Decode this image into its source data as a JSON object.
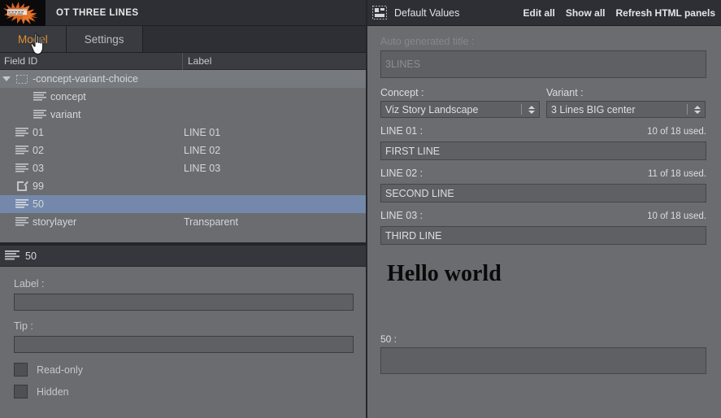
{
  "window": {
    "title": "OT THREE LINES",
    "logo_icon": "orange-splat-logo"
  },
  "tabs": [
    {
      "label": "Model",
      "active": true
    },
    {
      "label": "Settings",
      "active": false
    }
  ],
  "tree": {
    "columns": [
      "Field ID",
      "Label"
    ],
    "rows": [
      {
        "id": "-concept-variant-choice",
        "label": "",
        "icon": "dashed-box-icon",
        "indent": 0,
        "expandable": true,
        "expanded": true,
        "state": "root"
      },
      {
        "id": "concept",
        "label": "",
        "icon": "text-lines-icon",
        "indent": 2,
        "expandable": false,
        "state": "normal"
      },
      {
        "id": "variant",
        "label": "",
        "icon": "text-lines-icon",
        "indent": 2,
        "expandable": false,
        "state": "normal"
      },
      {
        "id": "01",
        "label": "LINE 01",
        "icon": "text-lines-icon",
        "indent": 1,
        "expandable": false,
        "state": "normal"
      },
      {
        "id": "02",
        "label": "LINE 02",
        "icon": "text-lines-icon",
        "indent": 1,
        "expandable": false,
        "state": "normal"
      },
      {
        "id": "03",
        "label": "LINE 03",
        "icon": "text-lines-icon",
        "indent": 1,
        "expandable": false,
        "state": "normal"
      },
      {
        "id": "99",
        "label": "",
        "icon": "edit-pencil-icon",
        "indent": 1,
        "expandable": false,
        "state": "normal"
      },
      {
        "id": "50",
        "label": "",
        "icon": "text-lines-icon",
        "indent": 1,
        "expandable": false,
        "state": "selected"
      },
      {
        "id": "storylayer",
        "label": "Transparent",
        "icon": "text-lines-icon",
        "indent": 1,
        "expandable": false,
        "state": "normal"
      }
    ]
  },
  "properties": {
    "header_title": "50",
    "header_icon": "text-lines-icon",
    "label_field": {
      "label": "Label :",
      "value": "",
      "placeholder": ""
    },
    "tip_field": {
      "label": "Tip :",
      "value": "",
      "placeholder": ""
    },
    "checkboxes": [
      {
        "label": "Read-only",
        "checked": false
      },
      {
        "label": "Hidden",
        "checked": false
      }
    ]
  },
  "right_panel": {
    "title": "Default Values",
    "title_icon": "panel-layout-icon",
    "actions": [
      {
        "label": "Edit all"
      },
      {
        "label": "Show all"
      },
      {
        "label": "Refresh HTML panels"
      }
    ],
    "auto_title": {
      "label": "Auto generated title :",
      "value": "3LINES"
    },
    "concept": {
      "label": "Concept :",
      "value": "Viz Story Landscape"
    },
    "variant": {
      "label": "Variant :",
      "value": "3 Lines BIG center"
    },
    "lines": [
      {
        "label": "LINE 01 :",
        "used": "10 of 18 used.",
        "value": "FIRST LINE"
      },
      {
        "label": "LINE 02 :",
        "used": "11 of 18 used.",
        "value": "SECOND LINE"
      },
      {
        "label": "LINE 03 :",
        "used": "10 of 18 used.",
        "value": "THIRD LINE"
      }
    ],
    "preview": {
      "text": "Hello world"
    },
    "bottom_field": {
      "label": "50 :",
      "value": ""
    }
  },
  "colors": {
    "accent_orange": "#e09030",
    "selection_blue": "#7388ab",
    "panel_bg": "#6a6c70",
    "chrome_dark": "#2d2f34"
  }
}
